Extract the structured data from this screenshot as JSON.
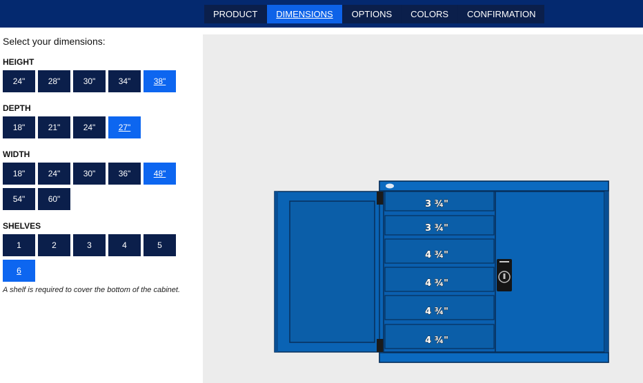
{
  "nav": {
    "tabs": [
      {
        "label": "PRODUCT"
      },
      {
        "label": "DIMENSIONS",
        "active": true
      },
      {
        "label": "OPTIONS"
      },
      {
        "label": "COLORS"
      },
      {
        "label": "CONFIRMATION"
      }
    ]
  },
  "form": {
    "intro": "Select your dimensions:",
    "height": {
      "title": "HEIGHT",
      "options": [
        "24\"",
        "28\"",
        "30\"",
        "34\"",
        "38\""
      ],
      "selected": "38\""
    },
    "depth": {
      "title": "DEPTH",
      "options": [
        "18\"",
        "21\"",
        "24\"",
        "27\""
      ],
      "selected": "27\""
    },
    "width": {
      "title": "WIDTH",
      "options": [
        "18\"",
        "24\"",
        "30\"",
        "36\"",
        "48\"",
        "54\"",
        "60\""
      ],
      "selected": "48\""
    },
    "shelves": {
      "title": "SHELVES",
      "options": [
        "1",
        "2",
        "3",
        "4",
        "5",
        "6"
      ],
      "selected": "6"
    },
    "note": "A shelf is required to cover the bottom of the cabinet."
  },
  "preview": {
    "shelf_labels": [
      "3 ¾\"",
      "3 ¾\"",
      "4 ¾\"",
      "4 ¾\"",
      "4 ¾\"",
      "4 ¾\""
    ],
    "colors": {
      "cabinet": "#0a63b4",
      "panel": "#0b5ea8",
      "outline": "#072f5a",
      "background": "#ececec"
    }
  },
  "colors": {
    "nav_bg": "#04296f",
    "button": "#0b1f4b",
    "selected": "#0d66f0"
  }
}
